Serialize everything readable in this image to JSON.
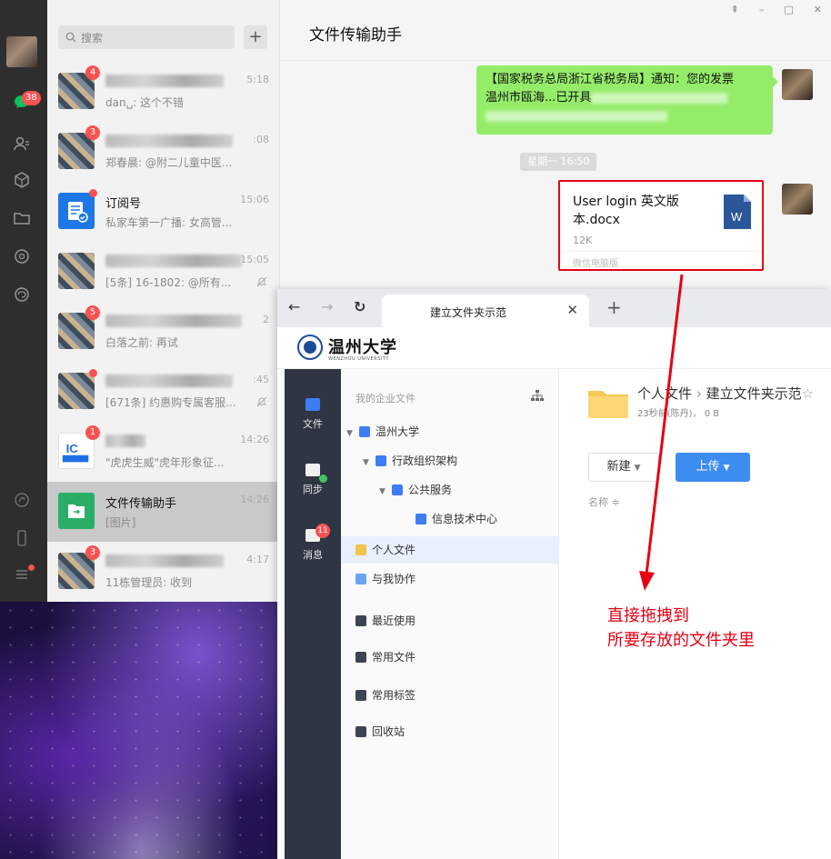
{
  "wechat": {
    "nav_badge": "38",
    "search_placeholder": "搜索",
    "add_label": "+",
    "chats": [
      {
        "badge": "4",
        "time": "5:18",
        "preview": "dan␣: 这个不错"
      },
      {
        "badge": "3",
        "time": ":08",
        "preview": "郑春晨: @附二儿童中医..."
      },
      {
        "name": "订阅号",
        "time": "15:06",
        "preview": "私家车第一广播: 女高管..."
      },
      {
        "time": "15:05",
        "preview": "[5条] 16-1802: @所有..."
      },
      {
        "badge": "5",
        "time": "2",
        "preview": "白落之前: 再试"
      },
      {
        "time": ":45",
        "preview": "[671条] 约惠购专属客服..."
      },
      {
        "badge": "1",
        "time": "14:26",
        "preview": "\"虎虎生威\"虎年形象征..."
      },
      {
        "name": "文件传输助手",
        "time": "14:26",
        "preview": "[图片]"
      },
      {
        "badge": "3",
        "time": "4:17",
        "preview": "11栋管理员: 收到"
      }
    ],
    "window": {
      "title": "文件传输助手",
      "controls": [
        "⇞",
        "–",
        "□",
        "✕"
      ],
      "message_line1": "【国家税务总局浙江省税务局】通知：您的发票",
      "message_line2": "温州市瓯海...已开具",
      "time_divider": "星期一 16:50",
      "file": {
        "name": "User  login 英文版本.docx",
        "size": "12K",
        "source": "微信电脑版",
        "icon_letter": "W"
      }
    }
  },
  "browser": {
    "tab_title": "建立文件夹示范",
    "university_name": "温州大学",
    "university_sub": "WENZHOU UNIVERSITY",
    "rail": [
      {
        "label": "文件"
      },
      {
        "label": "同步"
      },
      {
        "label": "消息",
        "badge": "11"
      }
    ],
    "tree": {
      "title": "我的企业文件",
      "nodes": [
        "温州大学",
        "行政组织架构",
        "公共服务",
        "信息技术中心"
      ],
      "personal": "个人文件",
      "shared": "与我协作",
      "recent": "最近使用",
      "favorites": "常用文件",
      "tags": "常用标签",
      "trash": "回收站"
    },
    "files": {
      "breadcrumb_root": "个人文件",
      "breadcrumb_sep": "›",
      "breadcrumb_current": "建立文件夹示范",
      "meta": "23秒前(陈丹)， 0 B",
      "new_label": "新建",
      "upload_label": "上传",
      "col_name": "名称 ≑"
    }
  },
  "annotation": {
    "line1": "直接拖拽到",
    "line2": "所要存放的文件夹里"
  },
  "colors": {
    "wechat_green": "#95ec69",
    "annotation_red": "#e60012",
    "upload_blue": "#3d8cf0",
    "rail_dark": "#2f3542"
  }
}
